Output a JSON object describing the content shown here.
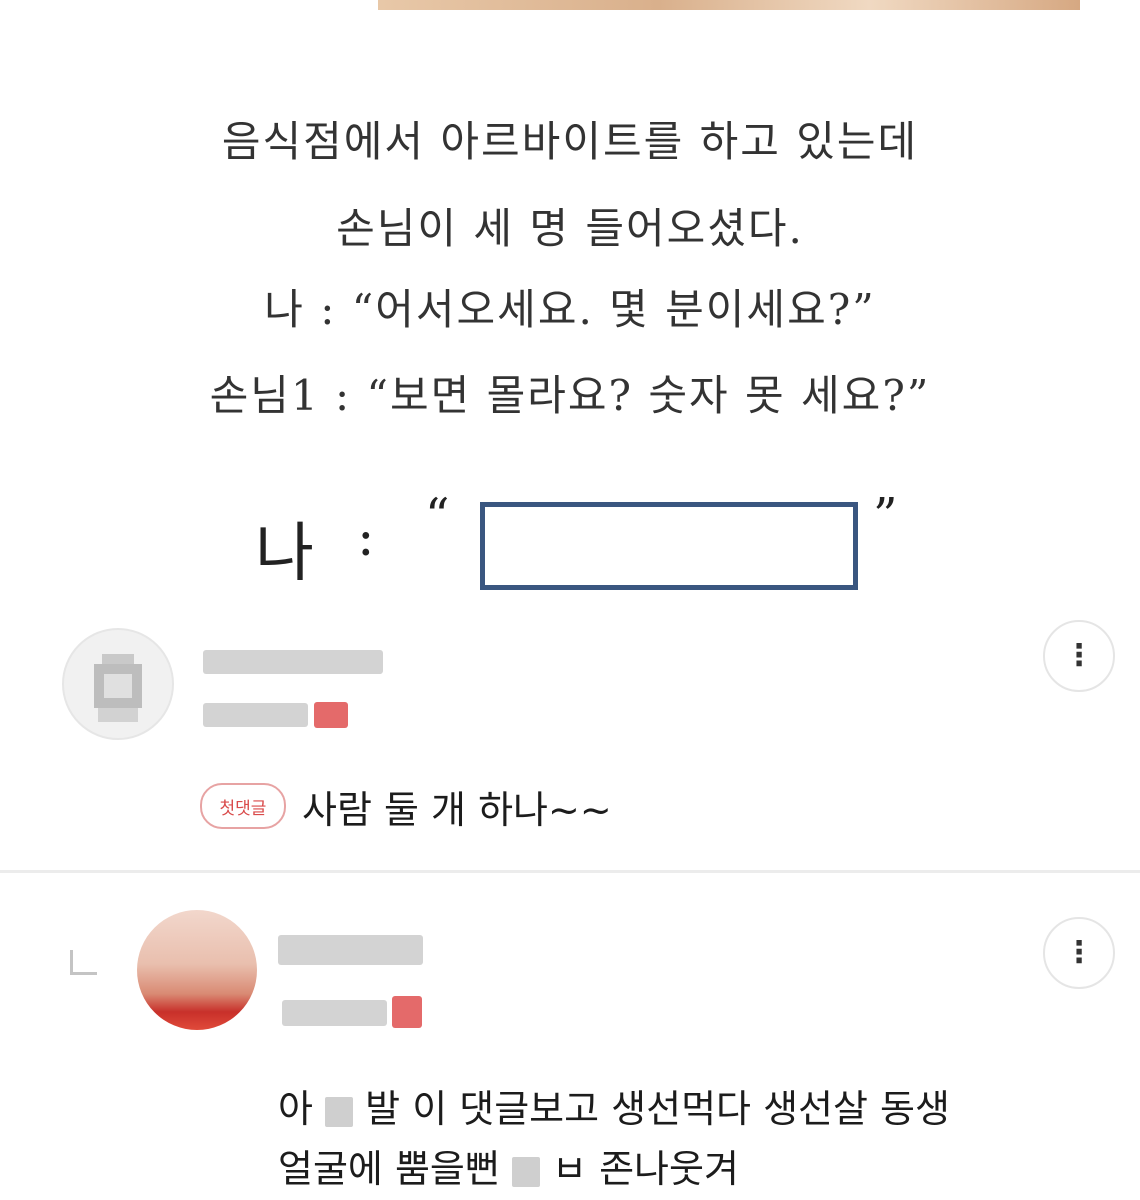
{
  "story": {
    "lines": [
      "음식점에서 아르바이트를 하고 있는데",
      "손님이 세 명 들어오셨다.",
      "나 : “어서오세요. 몇 분이세요?”",
      "손님1 : “보면 몰라요? 숫자 못 세요?”"
    ],
    "answer_speaker": "나",
    "answer_colon": ":",
    "quote_open": "“",
    "quote_close": "”"
  },
  "comments": [
    {
      "badge": "첫댓글",
      "text": "사람 둘 개 하나~~",
      "more_icon": "more-vertical-icon"
    },
    {
      "reply_icon": "reply-arrow-icon",
      "text_line1_a": "아",
      "text_line1_b": "발 이 댓글보고 생선먹다 생선살 동생",
      "text_line2_a": "얼굴에 뿜을뻔",
      "text_line2_b": "ㅂ 존나웃겨",
      "more_icon": "more-vertical-icon"
    }
  ],
  "colors": {
    "badge_red": "#d94a4a",
    "answer_box_border": "#3a5680"
  }
}
